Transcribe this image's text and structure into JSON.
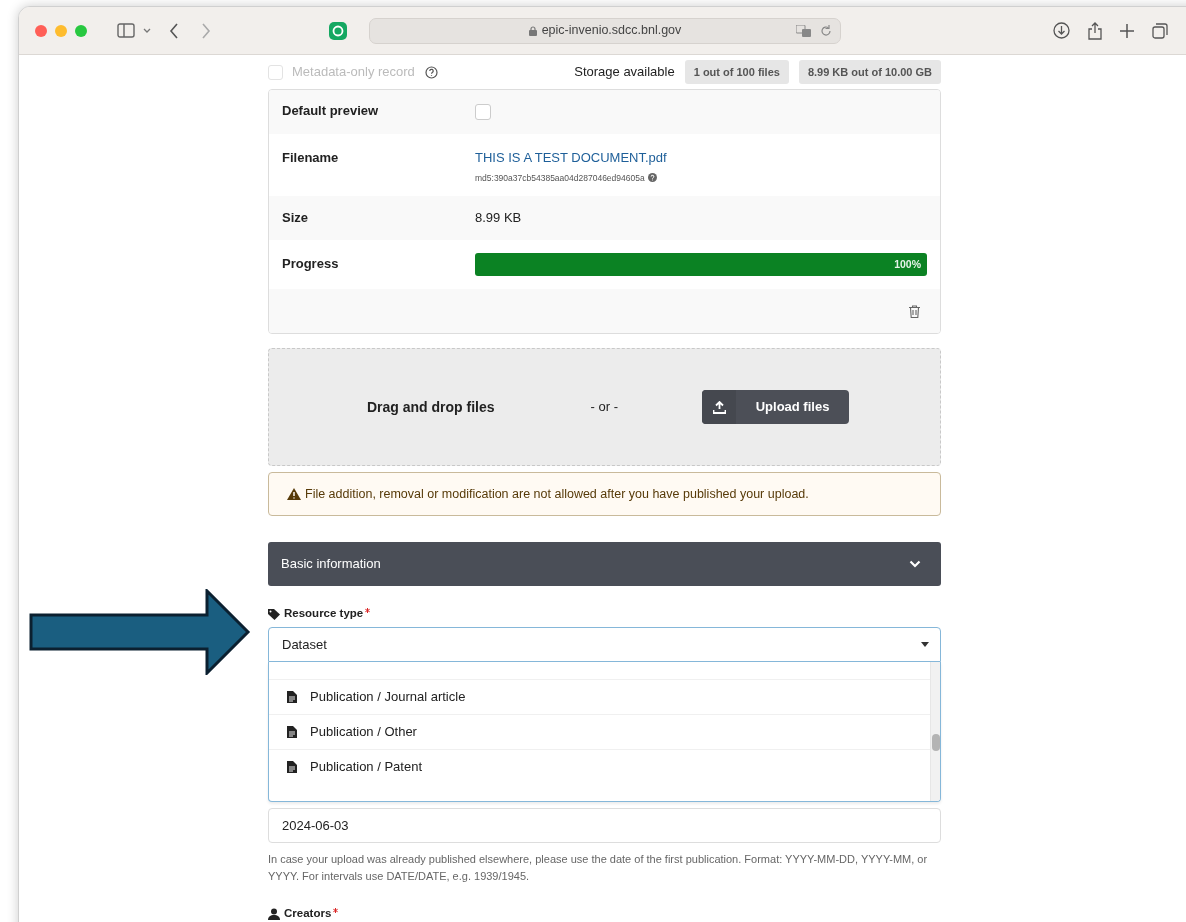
{
  "browser": {
    "url": "epic-invenio.sdcc.bnl.gov"
  },
  "metadata_only": {
    "label": "Metadata-only record",
    "checked": false,
    "disabled": true
  },
  "storage": {
    "label": "Storage available",
    "files": "1 out of 100 files",
    "size": "8.99 KB out of 10.00 GB"
  },
  "file": {
    "default_preview_label": "Default preview",
    "default_preview": false,
    "filename_label": "Filename",
    "filename": "THIS IS A TEST DOCUMENT.pdf",
    "checksum": "md5:390a37cb54385aa04d287046ed94605a",
    "size_label": "Size",
    "size": "8.99 KB",
    "progress_label": "Progress",
    "level": 1.0,
    "progress_text": "100%"
  },
  "dropzone": {
    "text": "Drag and drop files",
    "or": "- or -",
    "button": "Upload files"
  },
  "warning": "File addition, removal or modification are not allowed after you have published your upload.",
  "section": {
    "title": "Basic information",
    "expanded": true
  },
  "resource_type": {
    "label": "Resource type",
    "required": true,
    "value": "Dataset",
    "options": [
      {
        "label": "Publication / Journal article"
      },
      {
        "label": "Publication / Other"
      },
      {
        "label": "Publication / Patent"
      }
    ]
  },
  "publication_date": {
    "value": "2024-06-03",
    "help": "In case your upload was already published elsewhere, please use the date of the first publication. Format: YYYY-MM-DD, YYYY-MM, or YYYY. For intervals use DATE/DATE, e.g. 1939/1945."
  },
  "creators": {
    "label": "Creators",
    "required": true
  }
}
